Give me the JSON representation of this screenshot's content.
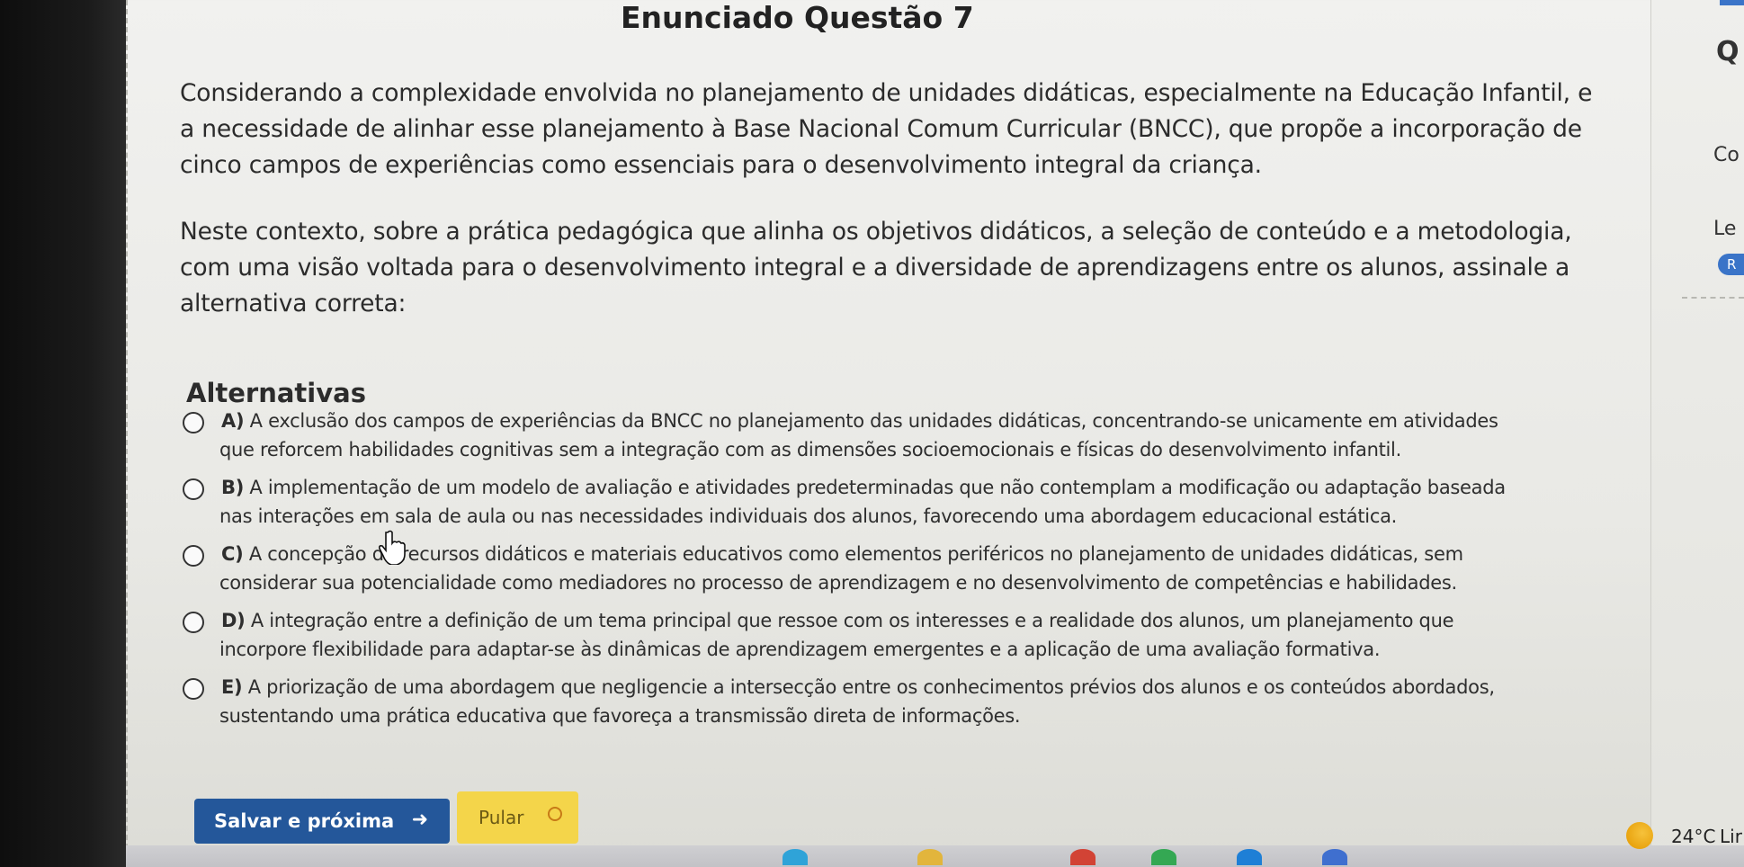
{
  "question": {
    "title": "Enunciado Questão 7",
    "paragraph1": [
      "Considerando a complexidade envolvida no planejamento de unidades didáticas, especialmente na Educação Infantil, e",
      "a necessidade de alinhar esse planejamento à Base Nacional Comum Curricular (BNCC), que propõe a incorporação de",
      "cinco campos de experiências como essenciais para o desenvolvimento integral da criança."
    ],
    "paragraph2": [
      "Neste contexto, sobre a prática pedagógica que alinha os objetivos didáticos, a seleção de conteúdo e a metodologia,",
      "com uma visão voltada para o desenvolvimento integral e a diversidade de aprendizagens entre os alunos, assinale a",
      "alternativa correta:"
    ]
  },
  "alternatives": {
    "heading": "Alternativas",
    "items": [
      {
        "letter": "A)",
        "line1": "A exclusão dos campos de experiências da BNCC no planejamento das unidades didáticas, concentrando-se unicamente em atividades",
        "line2": "que reforcem habilidades cognitivas sem a integração com as dimensões socioemocionais e físicas do desenvolvimento infantil."
      },
      {
        "letter": "B)",
        "line1": "A implementação de um modelo de avaliação e atividades predeterminadas que não contemplam a modificação ou adaptação baseada",
        "line2": "nas interações em sala de aula ou nas necessidades individuais dos alunos, favorecendo uma abordagem educacional estática."
      },
      {
        "letter": "C)",
        "line1": "A concepção de recursos didáticos e materiais educativos como elementos periféricos no planejamento de unidades didáticas, sem",
        "line2": "considerar sua potencialidade como mediadores no processo de aprendizagem e no desenvolvimento de competências e habilidades."
      },
      {
        "letter": "D)",
        "line1": "A integração entre a definição de um tema principal que ressoe com os interesses e a realidade dos alunos, um planejamento que",
        "line2": "incorpore flexibilidade para adaptar-se às dinâmicas de aprendizagem emergentes e a aplicação de uma avaliação formativa."
      },
      {
        "letter": "E)",
        "line1": "A priorização de uma abordagem que negligencie a intersecção entre os conhecimentos prévios dos alunos e os conteúdos abordados,",
        "line2": "sustentando uma prática educativa que favoreça a transmissão direta de informações."
      }
    ]
  },
  "actions": {
    "save_label": "Salvar e próxima",
    "skip_label": "Pular"
  },
  "side_panel": {
    "q_fragment": "Q",
    "co_fragment": "Co",
    "le_fragment": "Le",
    "badge_fragment": "R"
  },
  "taskbar": {
    "temperature": "24°C",
    "weather_fragment": "Lir"
  },
  "colors": {
    "primary_button": "#24579a",
    "skip_button": "#f4d54a",
    "accent_blue": "#3a74c8"
  }
}
